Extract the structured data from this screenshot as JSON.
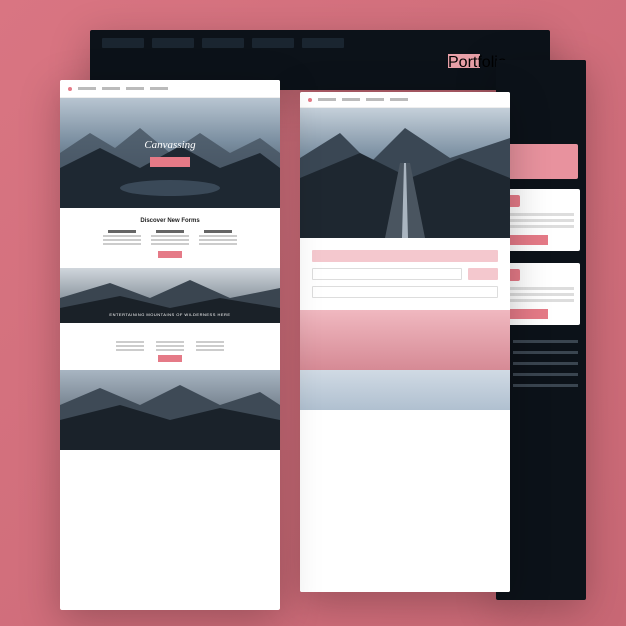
{
  "background_color": "#d97582",
  "accent_color": "#e57a87",
  "dark_color": "#0c1219",
  "mockups": {
    "back_strip": {
      "nav_items": [
        "",
        "",
        "",
        "",
        ""
      ],
      "accent_label": "Portfolio"
    },
    "left_page": {
      "nav": [
        "",
        "",
        "",
        ""
      ],
      "hero_title": "Canvassing",
      "hero_cta": "",
      "features_heading": "Discover New Forms",
      "features_columns": [
        {
          "heading": "",
          "lines": [
            "",
            "",
            ""
          ]
        },
        {
          "heading": "",
          "lines": [
            "",
            "",
            ""
          ]
        },
        {
          "heading": "",
          "lines": [
            "",
            "",
            ""
          ]
        }
      ],
      "wide_banner_text": "ENTERTAINING MOUNTAINS OF WILDERNESS HERE",
      "bottom_heading": "",
      "bottom_columns": [
        {
          "lines": [
            "",
            "",
            ""
          ]
        },
        {
          "lines": [
            "",
            "",
            ""
          ]
        },
        {
          "lines": [
            "",
            "",
            ""
          ]
        }
      ]
    },
    "right_page": {
      "nav": [
        "",
        "",
        "",
        ""
      ],
      "form_heading": "",
      "form_fields": [
        {
          "placeholder": ""
        },
        {
          "placeholder": ""
        },
        {
          "placeholder": ""
        }
      ],
      "submit_label": ""
    },
    "dark_sidebar": {
      "top_label": "",
      "card1": {
        "lines": [
          "",
          "",
          "",
          ""
        ],
        "cta": ""
      },
      "card2": {
        "lines": [
          "",
          "",
          "",
          ""
        ],
        "cta": ""
      },
      "list_items": [
        "",
        "",
        "",
        "",
        ""
      ]
    }
  }
}
